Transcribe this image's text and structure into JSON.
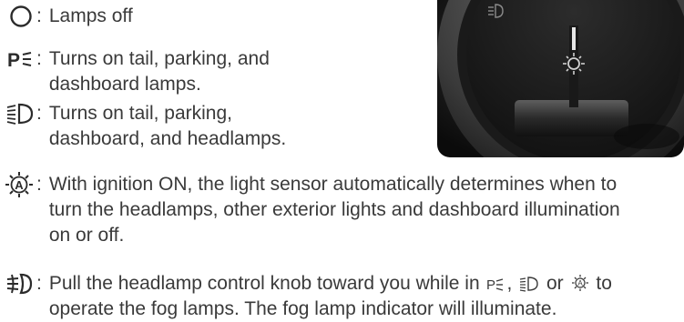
{
  "items": [
    {
      "icon": "circle-off-icon",
      "lines": [
        "Lamps off"
      ]
    },
    {
      "icon": "parking-lamps-icon",
      "lines": [
        "Turns on tail, parking, and",
        "dashboard lamps."
      ]
    },
    {
      "icon": "headlamp-icon",
      "lines": [
        "Turns on tail, parking,",
        "dashboard, and headlamps."
      ]
    },
    {
      "icon": "auto-lamp-icon",
      "lines": [
        "With ignition ON, the light sensor automatically determines when to",
        "turn the headlamps, other exterior lights and dashboard illumination",
        "on or off."
      ]
    },
    {
      "icon": "fog-lamp-icon",
      "line1_before": "Pull the headlamp control knob toward you while in",
      "line1_sep": ",",
      "line1_or": "or",
      "line1_after": "to",
      "line2": "operate the fog lamps. The fog lamp indicator will illuminate."
    }
  ],
  "colon": ":",
  "photo": {
    "icon": "headlamp-switch-photo"
  },
  "colors": {
    "text": "#3a3a3a",
    "icon": "#2b2b2b"
  }
}
